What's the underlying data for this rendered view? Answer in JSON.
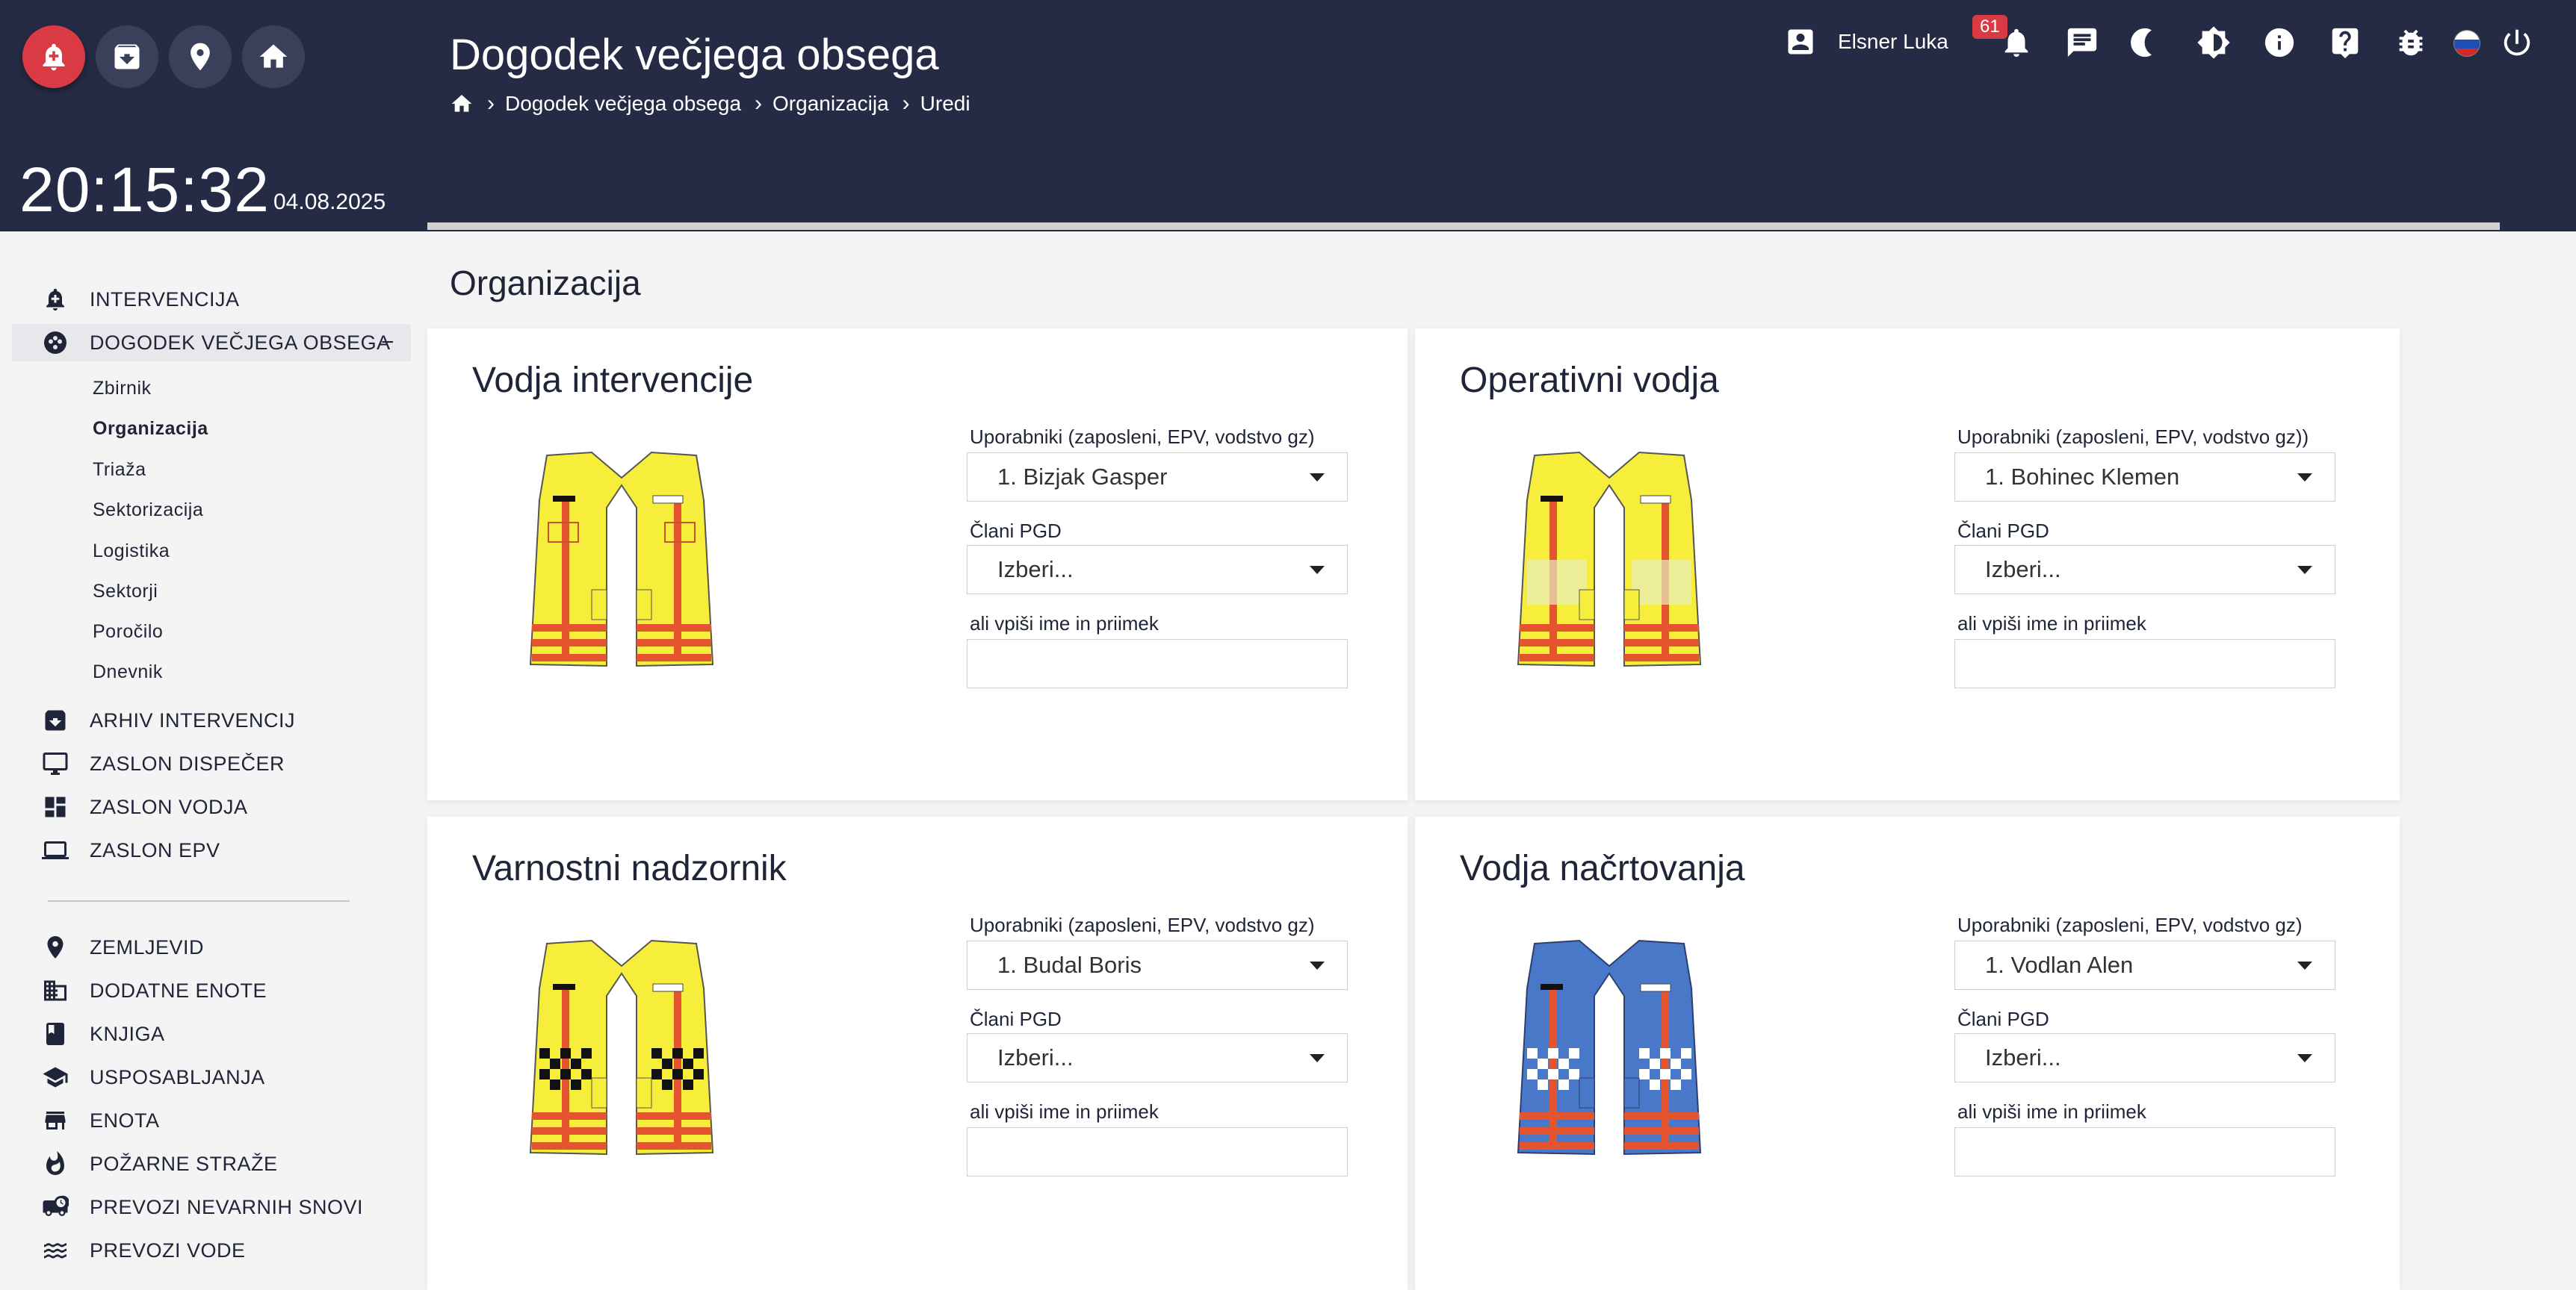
{
  "header": {
    "title": "Dogodek večjega obsega",
    "clock": "20:15:32",
    "date": "04.08.2025",
    "breadcrumb": [
      "Dogodek večjega obsega",
      "Organizacija",
      "Uredi"
    ],
    "user_name": "Elsner Luka",
    "notification_count": "61",
    "left_buttons": [
      "alarm-add-icon",
      "archive-icon",
      "map-pin-icon",
      "home-icon"
    ],
    "toolbar_icons": [
      "bell-icon",
      "chat-icon",
      "moon-icon",
      "brightness-icon",
      "info-icon",
      "help-icon",
      "bug-icon",
      "slovenia-flag-icon",
      "power-icon"
    ],
    "accent_color": "#d93a43",
    "background_color": "#262b45"
  },
  "sidebar": {
    "items": [
      {
        "label": "INTERVENCIJA",
        "icon": "alarm-icon"
      },
      {
        "label": "DOGODEK VEČJEGA OBSEGA",
        "icon": "incident-icon",
        "expanded": true,
        "collapse_symbol": "−"
      }
    ],
    "sub_items": [
      {
        "label": "Zbirnik"
      },
      {
        "label": "Organizacija",
        "active": true
      },
      {
        "label": "Triaža"
      },
      {
        "label": "Sektorizacija"
      },
      {
        "label": "Logistika"
      },
      {
        "label": "Sektorji"
      },
      {
        "label": "Poročilo"
      },
      {
        "label": "Dnevnik"
      }
    ],
    "items2": [
      {
        "label": "ARHIV INTERVENCIJ",
        "icon": "archive-icon"
      },
      {
        "label": "ZASLON DISPEČER",
        "icon": "monitor-icon"
      },
      {
        "label": "ZASLON VODJA",
        "icon": "dashboard-icon"
      },
      {
        "label": "ZASLON EPV",
        "icon": "laptop-icon"
      }
    ],
    "items3": [
      {
        "label": "ZEMLJEVID",
        "icon": "map-pin-icon"
      },
      {
        "label": "DODATNE ENOTE",
        "icon": "building-icon"
      },
      {
        "label": "KNJIGA",
        "icon": "book-icon"
      },
      {
        "label": "USPOSABLJANJA",
        "icon": "graduation-icon"
      },
      {
        "label": "ENOTA",
        "icon": "store-icon"
      },
      {
        "label": "POŽARNE STRAŽE",
        "icon": "fire-icon"
      },
      {
        "label": "PREVOZI NEVARNIH SNOVI",
        "icon": "truck-icon"
      },
      {
        "label": "PREVOZI VODE",
        "icon": "water-icon"
      }
    ]
  },
  "main": {
    "section_title": "Organizacija",
    "cards": [
      {
        "title": "Vodja intervencije",
        "vest": "yellow-commander",
        "users_label": "Uporabniki (zaposleni, EPV, vodstvo gz)",
        "users_value": "1. Bizjak Gasper",
        "pgd_label": "Člani PGD",
        "pgd_value": "Izberi...",
        "name_label": "ali vpiši ime in priimek",
        "name_value": ""
      },
      {
        "title": "Operativni vodja",
        "vest": "yellow-operative",
        "users_label": "Uporabniki (zaposleni, EPV, vodstvo gz))",
        "users_value": "1. Bohinec Klemen",
        "pgd_label": "Člani PGD",
        "pgd_value": "Izberi...",
        "name_label": "ali vpiši ime in priimek",
        "name_value": ""
      },
      {
        "title": "Varnostni nadzornik",
        "vest": "yellow-checkered",
        "users_label": "Uporabniki (zaposleni, EPV, vodstvo gz)",
        "users_value": "1. Budal Boris",
        "pgd_label": "Člani PGD",
        "pgd_value": "Izberi...",
        "name_label": "ali vpiši ime in priimek",
        "name_value": ""
      },
      {
        "title": "Vodja načrtovanja",
        "vest": "blue-checkered",
        "users_label": "Uporabniki (zaposleni, EPV, vodstvo gz)",
        "users_value": "1. Vodlan Alen",
        "pgd_label": "Člani PGD",
        "pgd_value": "Izberi...",
        "name_label": "ali vpiši ime in priimek",
        "name_value": ""
      }
    ]
  }
}
